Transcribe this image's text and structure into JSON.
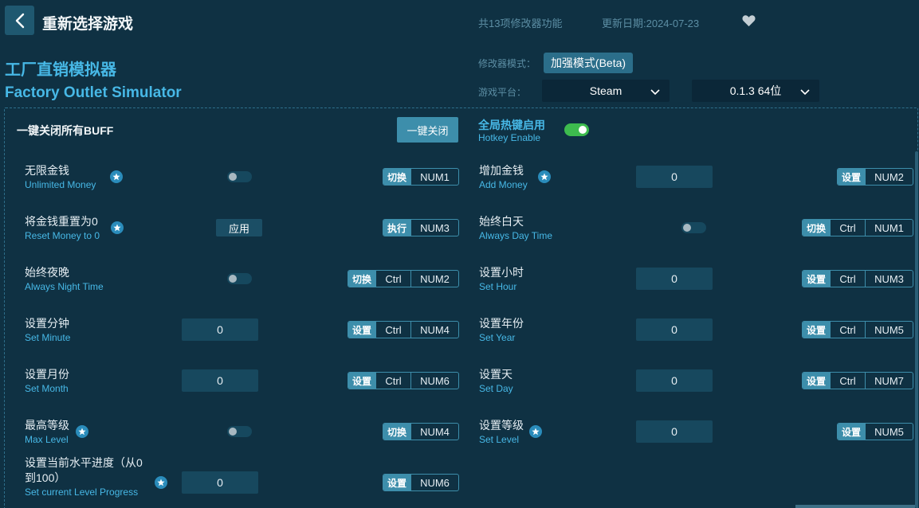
{
  "header": {
    "back_icon": "chevron-left-icon",
    "title": "重新选择游戏",
    "feature_count": "共13项修改器功能",
    "update_date": "更新日期:2024-07-23",
    "heart_icon": "heart-icon"
  },
  "game": {
    "title_cn": "工厂直销模拟器",
    "title_en": "Factory Outlet Simulator"
  },
  "settings": {
    "mode_label": "修改器模式：",
    "mode_value": "加强模式(Beta)",
    "platform_label": "游戏平台：",
    "platform_value": "Steam",
    "version_value": "0.1.3 64位"
  },
  "controls": {
    "buff_label": "一键关闭所有BUFF",
    "close_all_label": "一键关闭",
    "hotkey_cn": "全局热键启用",
    "hotkey_en": "Hotkey Enable",
    "hotkey_enabled": true
  },
  "cheats": [
    {
      "cn": "无限金钱",
      "en": "Unlimited Money",
      "control": "toggle",
      "enabled": false,
      "action": "切换",
      "keys": [
        "NUM1"
      ],
      "star": true
    },
    {
      "cn": "增加金钱",
      "en": "Add Money",
      "control": "input",
      "value": "0",
      "action": "设置",
      "keys": [
        "NUM2"
      ],
      "star": true
    },
    {
      "cn": "将金钱重置为0",
      "en": "Reset Money to 0",
      "control": "button",
      "button_label": "应用",
      "action": "执行",
      "keys": [
        "NUM3"
      ],
      "star": true
    },
    {
      "cn": "始终白天",
      "en": "Always Day Time",
      "control": "toggle",
      "enabled": false,
      "action": "切换",
      "keys": [
        "Ctrl",
        "NUM1"
      ],
      "star": false
    },
    {
      "cn": "始终夜晚",
      "en": "Always Night Time",
      "control": "toggle",
      "enabled": false,
      "action": "切换",
      "keys": [
        "Ctrl",
        "NUM2"
      ],
      "star": false
    },
    {
      "cn": "设置小时",
      "en": "Set Hour",
      "control": "input",
      "value": "0",
      "action": "设置",
      "keys": [
        "Ctrl",
        "NUM3"
      ],
      "star": false
    },
    {
      "cn": "设置分钟",
      "en": "Set Minute",
      "control": "input",
      "value": "0",
      "action": "设置",
      "keys": [
        "Ctrl",
        "NUM4"
      ],
      "star": false
    },
    {
      "cn": "设置年份",
      "en": "Set Year",
      "control": "input",
      "value": "0",
      "action": "设置",
      "keys": [
        "Ctrl",
        "NUM5"
      ],
      "star": false
    },
    {
      "cn": "设置月份",
      "en": "Set Month",
      "control": "input",
      "value": "0",
      "action": "设置",
      "keys": [
        "Ctrl",
        "NUM6"
      ],
      "star": false
    },
    {
      "cn": "设置天",
      "en": "Set Day",
      "control": "input",
      "value": "0",
      "action": "设置",
      "keys": [
        "Ctrl",
        "NUM7"
      ],
      "star": false
    },
    {
      "cn": "最高等级",
      "en": "Max Level",
      "control": "toggle",
      "enabled": false,
      "action": "切换",
      "keys": [
        "NUM4"
      ],
      "star": true
    },
    {
      "cn": "设置等级",
      "en": "Set Level",
      "control": "input",
      "value": "0",
      "action": "设置",
      "keys": [
        "NUM5"
      ],
      "star": true
    },
    {
      "cn_line1": "设置当前水平进度（从0",
      "cn_line2": "到100）",
      "en": "Set current Level Progress",
      "control": "input",
      "value": "0",
      "action": "设置",
      "keys": [
        "NUM6"
      ],
      "star": true
    }
  ]
}
